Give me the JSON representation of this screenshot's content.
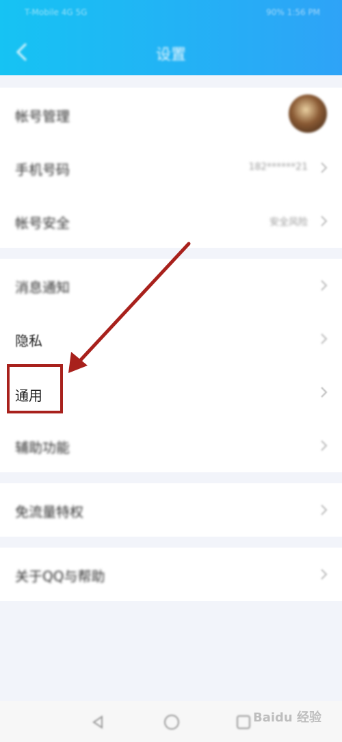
{
  "status_bar": {
    "left_text": "T-Mobile 4G 5G",
    "right_text": "90% 1:56 PM"
  },
  "header": {
    "title": "设置",
    "back_label": "返回"
  },
  "sections": {
    "account": {
      "account_manage": {
        "label": "帐号管理"
      },
      "phone": {
        "label": "手机号码",
        "value": "182******21"
      },
      "security": {
        "label": "帐号安全",
        "value": "安全风险"
      }
    },
    "settings": {
      "notifications": {
        "label": "消息通知"
      },
      "privacy": {
        "label": "隐私"
      },
      "general": {
        "label": "通用"
      },
      "accessibility": {
        "label": "辅助功能"
      }
    },
    "data": {
      "free_data": {
        "label": "免流量特权"
      }
    },
    "about": {
      "about_help": {
        "label": "关于QQ与帮助"
      }
    }
  },
  "annotation": {
    "highlight_color": "#a8211c"
  },
  "watermark": {
    "text": "Baidu 经验"
  },
  "colors": {
    "header_start": "#16c3f3",
    "header_end": "#2ea3f7",
    "background": "#f2f4fa"
  }
}
